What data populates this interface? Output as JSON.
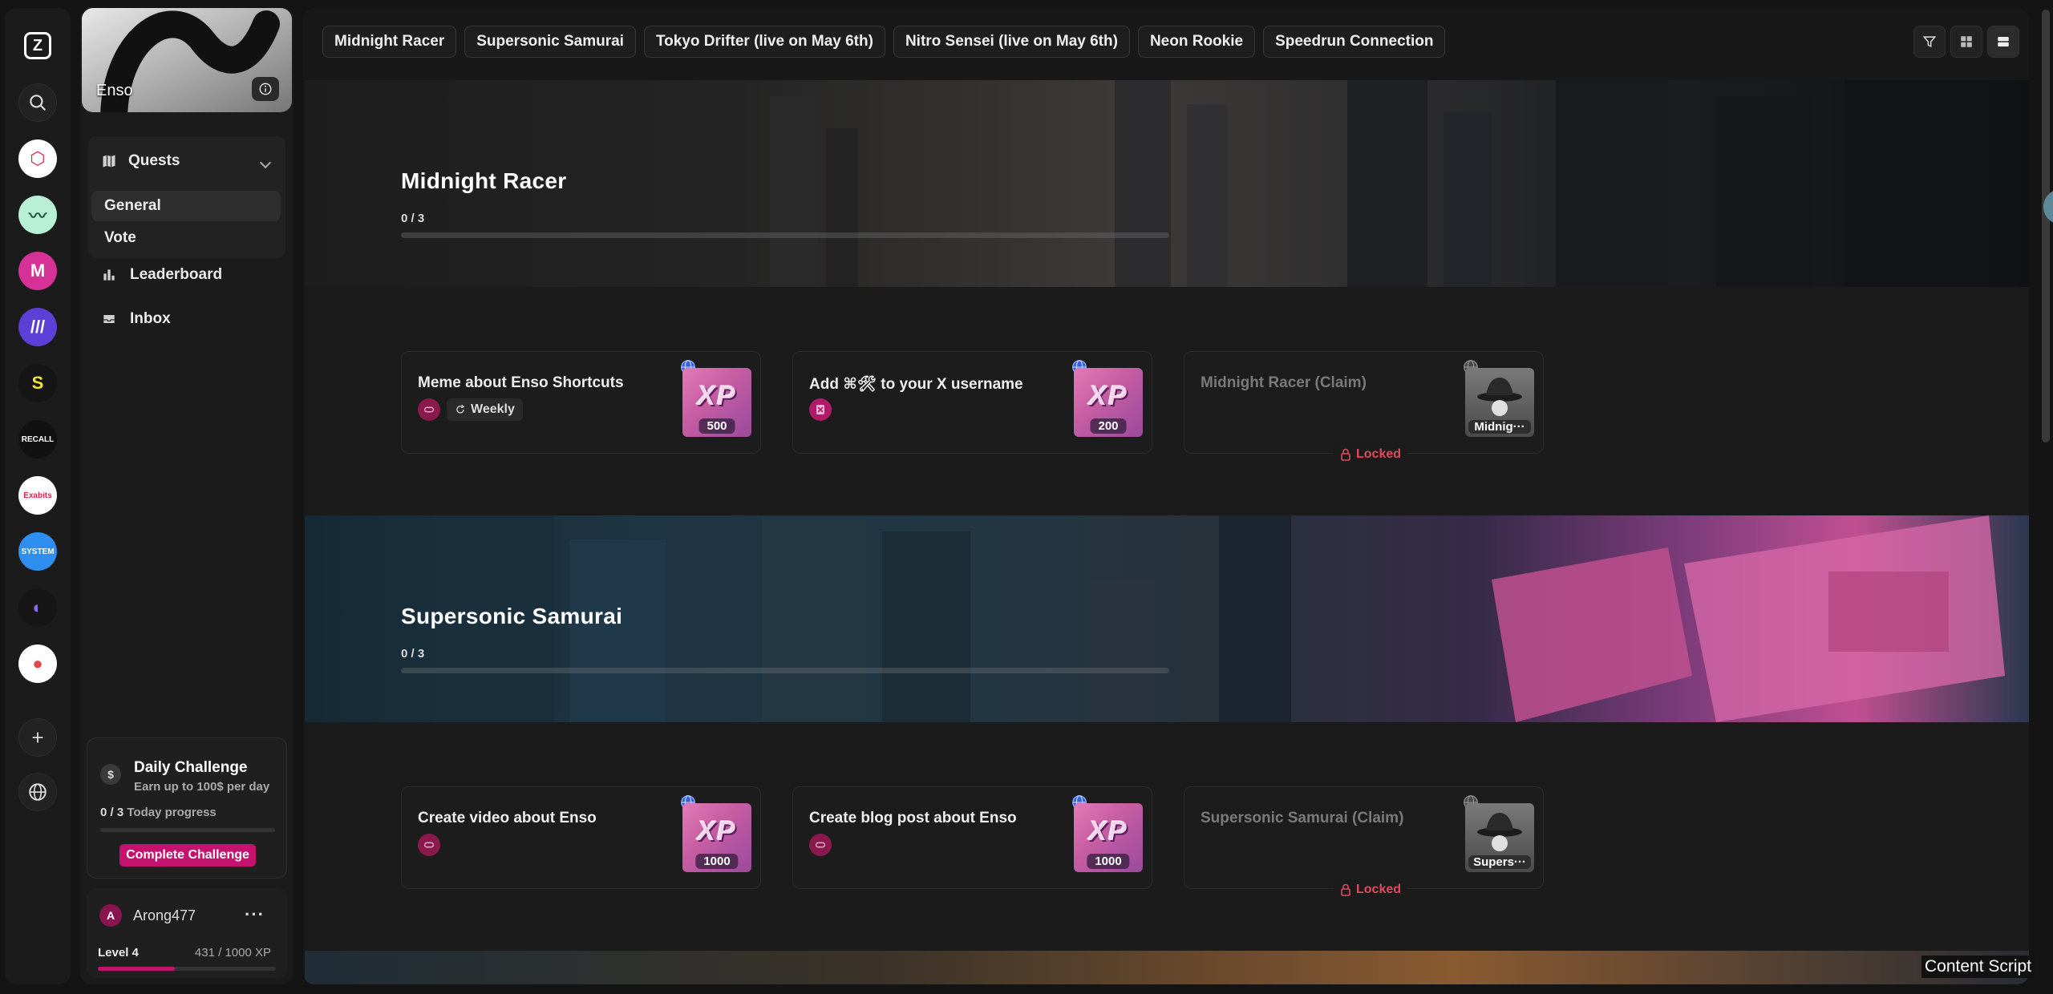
{
  "rail": {
    "logo": "Z",
    "apps": [
      {
        "name": "app-red-hexagon",
        "color": "#ffffff",
        "glyph": "⬡",
        "fg": "#e0284e"
      },
      {
        "name": "app-mint-wave",
        "color": "#b7f0d4",
        "glyph": "〰",
        "fg": "#1d5c43"
      },
      {
        "name": "app-pink-m",
        "color": "#d63196",
        "glyph": "M",
        "fg": "#ffffff"
      },
      {
        "name": "app-purple-stripes",
        "color": "#5b3fd6",
        "glyph": "///",
        "fg": "#ffffff"
      },
      {
        "name": "app-yellow-s",
        "color": "#151515",
        "glyph": "S",
        "fg": "#f4e23d"
      },
      {
        "name": "app-recall",
        "color": "#111111",
        "glyph": "RECALL",
        "fg": "#ffffff"
      },
      {
        "name": "app-exabits",
        "color": "#ffffff",
        "glyph": "Exabits",
        "fg": "#e0284e"
      },
      {
        "name": "app-system",
        "color": "#2f8ff0",
        "glyph": "SYSTEM",
        "fg": "#ffffff"
      },
      {
        "name": "app-gradient-swirl",
        "color": "#161616",
        "glyph": "◐",
        "fg": "#8a6bf0"
      },
      {
        "name": "app-circles",
        "color": "#ffffff",
        "glyph": "●",
        "fg": "#e04848"
      }
    ]
  },
  "panel": {
    "brand": "Enso",
    "quests_label": "Quests",
    "sub_items": [
      "General",
      "Vote"
    ],
    "leaderboard_label": "Leaderboard",
    "inbox_label": "Inbox",
    "challenge": {
      "title": "Daily Challenge",
      "subtitle": "Earn up to 100$ per day",
      "progress_count": "0 / 3",
      "progress_label": "Today progress",
      "button": "Complete Challenge",
      "progress_fraction": 0
    },
    "user": {
      "initial": "A",
      "name": "Arong477",
      "more": "···",
      "level": "Level 4",
      "xp": "431 / 1000 XP",
      "xp_fraction": 0.431
    }
  },
  "tabs": [
    "Midnight Racer",
    "Supersonic Samurai",
    "Tokyo Drifter (live on May 6th)",
    "Nitro Sensei (live on May 6th)",
    "Neon Rookie",
    "Speedrun Connection"
  ],
  "sections": [
    {
      "title": "Midnight Racer",
      "progress": "0 / 3",
      "progress_fraction": 0,
      "quests": [
        {
          "title": "Meme about Enso Shortcuts",
          "icon": "link-icon",
          "badge": "Weekly",
          "xp": "500"
        },
        {
          "title": "Add ⌘🛠 to your X username",
          "icon": "x-logo-icon",
          "xp": "200"
        },
        {
          "title": "Midnight Racer (Claim)",
          "locked": "Locked",
          "badge_name": "Midnig···"
        }
      ]
    },
    {
      "title": "Supersonic Samurai",
      "progress": "0 / 3",
      "progress_fraction": 0,
      "quests": [
        {
          "title": "Create video about Enso",
          "icon": "link-icon",
          "xp": "1000"
        },
        {
          "title": "Create blog post about Enso",
          "icon": "link-icon",
          "xp": "1000"
        },
        {
          "title": "Supersonic Samurai (Claim)",
          "locked": "Locked",
          "badge_name": "Supers···"
        }
      ]
    }
  ],
  "xp_label": "XP",
  "overlay": "Content Script"
}
